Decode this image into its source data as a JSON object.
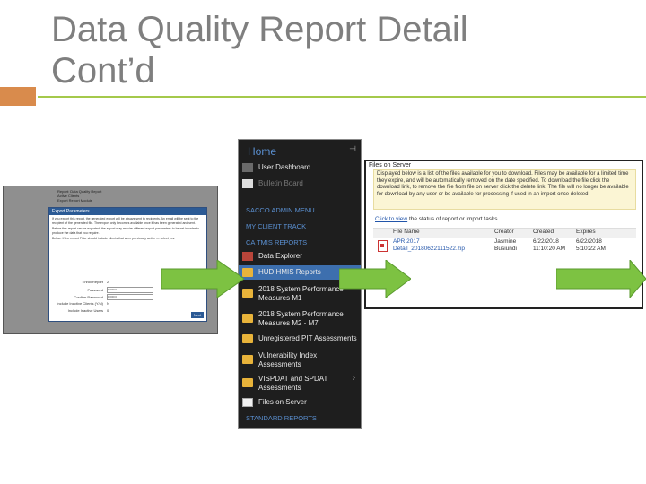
{
  "title": {
    "line1": "Data Quality Report Detail",
    "line2": "Cont’d"
  },
  "left_screenshot": {
    "dialog_title": "Export Parameters",
    "dialog_text": "If you export this report, the generated export will be always sent to recipients. An email will be sent to the recipient of the generated file. The export only becomes available once it has been generated and sent.",
    "dialog_text2": "Before this report can be exported, the export may require different export parameters to be set in order to produce the data that you require.",
    "dialog_text3": "Below: If the export Filter should include clients that were previously active — select yes.",
    "fields": [
      {
        "label": "Enroll Report",
        "value": "2",
        "type": "plain"
      },
      {
        "label": "Password",
        "value": "••••••••",
        "type": "input"
      },
      {
        "label": "Confirm Password",
        "value": "••••••••",
        "type": "input"
      },
      {
        "label": "Include Inactive Clients (Y/N)",
        "value": "N",
        "type": "plain"
      },
      {
        "label": "Include Inactive Users",
        "value": "0",
        "type": "plain"
      }
    ],
    "button": "Next",
    "behind_lines": [
      "Report: Data Quality Report",
      "Active Clients",
      "Export Report Module"
    ]
  },
  "menu": {
    "home": "Home",
    "pin": "⊣",
    "items": [
      {
        "label": "User Dashboard",
        "dim": false,
        "icon": "dashboard-icon"
      },
      {
        "label": "Bulletin Board",
        "dim": true,
        "icon": "bulletin-icon"
      }
    ],
    "headers": [
      "SACCO ADMIN MENU",
      "MY CLIENT TRACK",
      "CA TMIS REPORTS"
    ],
    "report_items": [
      {
        "label": "Data Explorer",
        "icon": "red-book-icon"
      },
      {
        "label": "HUD HMIS Reports",
        "icon": "folder-icon",
        "selected": true
      },
      {
        "label": "2018 System Performance",
        "label2": "Measures M1",
        "icon": "folder-icon"
      },
      {
        "label": "2018 System Performance",
        "label2": "Measures M2 - M7",
        "icon": "folder-icon"
      },
      {
        "label": "Unregistered PIT Assessments",
        "icon": "folder-icon"
      },
      {
        "label": "Vulnerability Index",
        "label2": "Assessments",
        "icon": "folder-icon"
      },
      {
        "label": "VISPDAT and SPDAT",
        "label2": "Assessments",
        "icon": "folder-icon"
      },
      {
        "label": "Files on Server",
        "icon": "checklist-icon"
      }
    ],
    "footer": "STANDARD REPORTS"
  },
  "right_screenshot": {
    "header": "Files on Server",
    "notice": "Displayed below is a list of the files available for you to download. Files may be available for a limited time they expire, and will be automatically removed on the date specified. To download the file click the download link, to remove the file from file on server click the delete link. The file will no longer be available for download by any user or be available for processing if used in an import once deleted.",
    "click_prefix": "Click to view",
    "click_suffix": "the status of report or import tasks",
    "columns": [
      "File Name",
      "Creator",
      "Created",
      "Expires"
    ],
    "rows": [
      {
        "name": "APR 2017",
        "creator": "Jasmine",
        "created": "6/22/2018",
        "expires": "6/22/2018",
        "icon": "pdf-icon"
      },
      {
        "name": "Detail_20180622111522.zip",
        "creator": "Busiundi",
        "created": "11:10:20 AM",
        "expires": "5:10:22 AM",
        "icon": "excel-icon"
      }
    ]
  },
  "colors": {
    "title": "#7f7f7f",
    "accent_orange": "#d98b4c",
    "accent_green": "#a4c94b",
    "arrow_green": "#7dc242",
    "menu_bg": "#1e1e1e",
    "menu_link": "#5a8fd0"
  }
}
